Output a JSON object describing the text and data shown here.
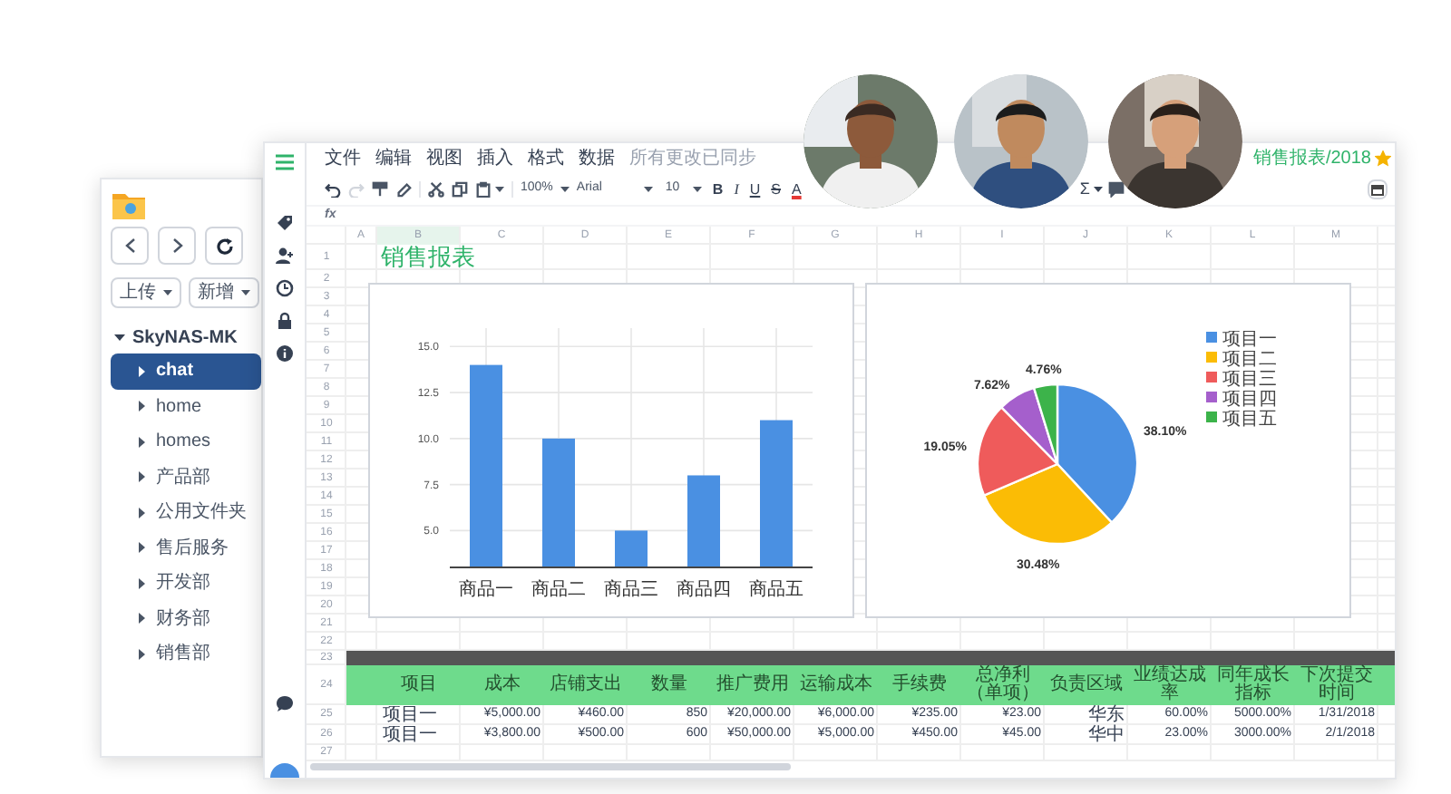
{
  "file_manager": {
    "actions": [
      {
        "label": "上传"
      },
      {
        "label": "新增"
      }
    ],
    "tree": {
      "label": "SkyNAS-MK",
      "expanded": true,
      "children": [
        {
          "label": "chat",
          "selected": true,
          "expanded": false
        },
        {
          "label": "home",
          "selected": false,
          "expanded": false
        },
        {
          "label": "homes",
          "selected": false,
          "expanded": false
        },
        {
          "label": "产品部",
          "selected": false,
          "expanded": false
        },
        {
          "label": "公用文件夹",
          "selected": false,
          "expanded": false
        },
        {
          "label": "售后服务",
          "selected": false,
          "expanded": false
        },
        {
          "label": "开发部",
          "selected": false,
          "expanded": false
        },
        {
          "label": "财务部",
          "selected": false,
          "expanded": false
        },
        {
          "label": "销售部",
          "selected": false,
          "expanded": false
        }
      ]
    }
  },
  "spreadsheet": {
    "menu": [
      "文件",
      "编辑",
      "视图",
      "插入",
      "格式",
      "数据"
    ],
    "sync_status": "所有更改已同步",
    "document_title": "销售报表/2018",
    "starred": true,
    "history": [
      {
        "kind": "undo",
        "disabled": false
      },
      {
        "kind": "redo",
        "disabled": true
      }
    ],
    "zoom": "100%",
    "font": "Arial",
    "font_size": "10",
    "format_buttons": [
      "B",
      "I",
      "U",
      "S",
      "A"
    ],
    "sum_button": "Σ",
    "formula_label": "fx",
    "columns": [
      {
        "label": "A",
        "selected": false
      },
      {
        "label": "B",
        "selected": true
      },
      {
        "label": "C",
        "selected": false
      },
      {
        "label": "D",
        "selected": false
      },
      {
        "label": "E",
        "selected": false
      },
      {
        "label": "F",
        "selected": false
      },
      {
        "label": "G",
        "selected": false
      },
      {
        "label": "H",
        "selected": false
      },
      {
        "label": "I",
        "selected": false
      },
      {
        "label": "J",
        "selected": false
      },
      {
        "label": "K",
        "selected": false
      },
      {
        "label": "L",
        "selected": false
      },
      {
        "label": "M",
        "selected": false
      }
    ],
    "row_numbers": [
      "1",
      "2",
      "3",
      "4",
      "5",
      "6",
      "7",
      "8",
      "9",
      "10",
      "11",
      "12",
      "13",
      "14",
      "15",
      "16",
      "17",
      "18",
      "19",
      "20",
      "21",
      "22",
      "23",
      "24",
      "25",
      "26",
      "27"
    ],
    "sheet_title": "销售报表",
    "table": {
      "columns": [
        "项目",
        "成本",
        "店铺支出",
        "数量",
        "推广费用",
        "运输成本",
        "手续费",
        "总净利（单项）",
        "负责区域",
        "业绩达成率",
        "同年成长指标",
        "下次提交时间"
      ],
      "rows": [
        [
          "项目一",
          "¥5,000.00",
          "¥460.00",
          "850",
          "¥20,000.00",
          "¥6,000.00",
          "¥235.00",
          "¥23.00",
          "华东",
          "60.00%",
          "5000.00%",
          "1/31/2018"
        ],
        [
          "项目一",
          "¥3,800.00",
          "¥500.00",
          "600",
          "¥50,000.00",
          "¥5,000.00",
          "¥450.00",
          "¥45.00",
          "华中",
          "23.00%",
          "3000.00%",
          "2/1/2018"
        ]
      ]
    },
    "bar_chart": {
      "chart_data": {
        "type": "bar",
        "categories": [
          "商品一",
          "商品二",
          "商品三",
          "商品四",
          "商品五"
        ],
        "series": [
          {
            "color": "#4a90e2",
            "values": [
              14,
              10,
              5,
              8,
              11
            ]
          }
        ],
        "grid": true,
        "ylim": [
          3,
          16
        ],
        "yticks": [
          {
            "value": 5,
            "label": "5.0"
          },
          {
            "value": 7.5,
            "label": "7.5"
          },
          {
            "value": 10,
            "label": "10.0"
          },
          {
            "value": 12.5,
            "label": "12.5"
          },
          {
            "value": 15,
            "label": "15.0"
          }
        ]
      }
    },
    "pie_chart": {
      "chart_data": {
        "type": "pie",
        "categories": [
          "项目一",
          "项目二",
          "项目三",
          "项目四",
          "项目五"
        ],
        "values": [
          38.1,
          30.48,
          19.05,
          7.62,
          4.76
        ],
        "colors": [
          "#4a90e2",
          "#fbbc05",
          "#ef5b5b",
          "#a55fcc",
          "#3cb34a"
        ],
        "value_labels": [
          "38.10%",
          "30.48%",
          "19.05%",
          "7.62%",
          "4.76%"
        ],
        "legend": true
      }
    }
  }
}
